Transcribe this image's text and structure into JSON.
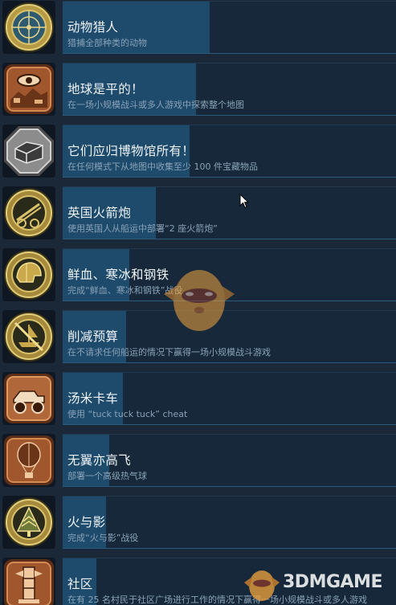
{
  "achievements": [
    {
      "title": "动物猎人",
      "description": "猎捕全部种类的动物",
      "progress": 0.44,
      "icon": "crosshair-medal-icon",
      "icon_style": "gold"
    },
    {
      "title": "地球是平的！",
      "description": "在一场小规模战斗或多人游戏中探索整个地图",
      "progress": 0.4,
      "icon": "eye-landscape-icon",
      "icon_style": "bronze"
    },
    {
      "title": "它们应归博物馆所有！",
      "description": "在任何模式下从地图中收集至少 100 件宝藏物品",
      "progress": 0.38,
      "icon": "treasure-chest-icon",
      "icon_style": "silver"
    },
    {
      "title": "英国火箭炮",
      "description": "使用英国人从船运中部署“2 座火箭炮”",
      "progress": 0.28,
      "icon": "rocket-artillery-icon",
      "icon_style": "gold"
    },
    {
      "title": "鲜血、寒冰和钢铁",
      "description": "完成“鲜血、寒冰和钢铁”战役",
      "progress": 0.2,
      "icon": "helmet-icon",
      "icon_style": "gold"
    },
    {
      "title": "削减预算",
      "description": "在不请求任何船运的情况下赢得一场小规模战斗游戏",
      "progress": 0.19,
      "icon": "crossed-ship-icon",
      "icon_style": "gold"
    },
    {
      "title": "汤米卡车",
      "description": "使用 “tuck tuck tuck” cheat",
      "progress": 0.18,
      "icon": "monster-truck-icon",
      "icon_style": "bronze"
    },
    {
      "title": "无翼亦高飞",
      "description": "部署一个高级热气球",
      "progress": 0.14,
      "icon": "hot-air-balloon-icon",
      "icon_style": "bronze"
    },
    {
      "title": "火与影",
      "description": "完成“火与影”战役",
      "progress": 0.13,
      "icon": "arrow-tree-icon",
      "icon_style": "gold"
    },
    {
      "title": "社区",
      "description": "在有 25 名村民于社区广场进行工作的情况下赢得一场小规模战斗或多人游戏",
      "progress": 0.1,
      "icon": "totem-icon",
      "icon_style": "bronze"
    }
  ],
  "watermark": {
    "text": "3DMGAME"
  },
  "colors": {
    "background": "#1b2838",
    "progress_bar": "#1e4a6c",
    "title": "#eef4f8",
    "description": "#8aa3b7"
  }
}
